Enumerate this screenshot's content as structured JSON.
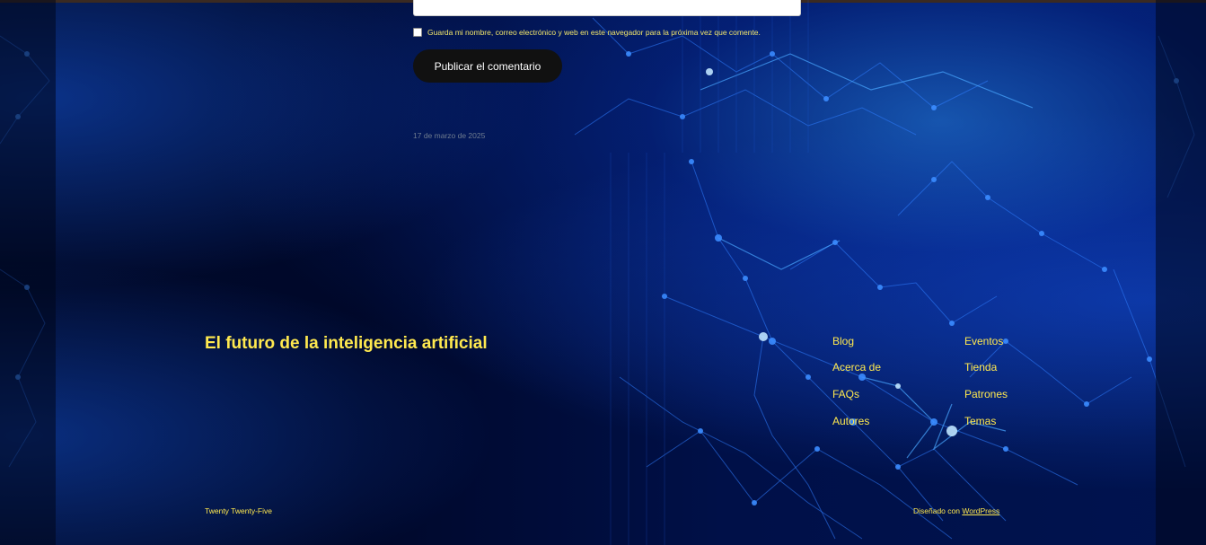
{
  "comment_form": {
    "comment_value": "",
    "cookies_consent_label": "Guarda mi nombre, correo electrónico y web en este navegador para la próxima vez que comente.",
    "cookies_checked": false,
    "submit_label": "Publicar el comentario"
  },
  "post": {
    "date": "17 de marzo de 2025"
  },
  "footer": {
    "site_title": "El futuro de la inteligencia artificial",
    "nav_column_1": [
      "Blog",
      "Acerca de",
      "FAQs",
      "Autores"
    ],
    "nav_column_2": [
      "Eventos",
      "Tienda",
      "Patrones",
      "Temas"
    ],
    "theme_name": "Twenty Twenty-Five",
    "credit_prefix": "Diseñado con",
    "credit_link": "WordPress"
  },
  "colors": {
    "link_yellow": "#ffe94f",
    "button_dark": "#111111",
    "background_navy": "#000b20",
    "accent_blue": "#1e6bff"
  }
}
